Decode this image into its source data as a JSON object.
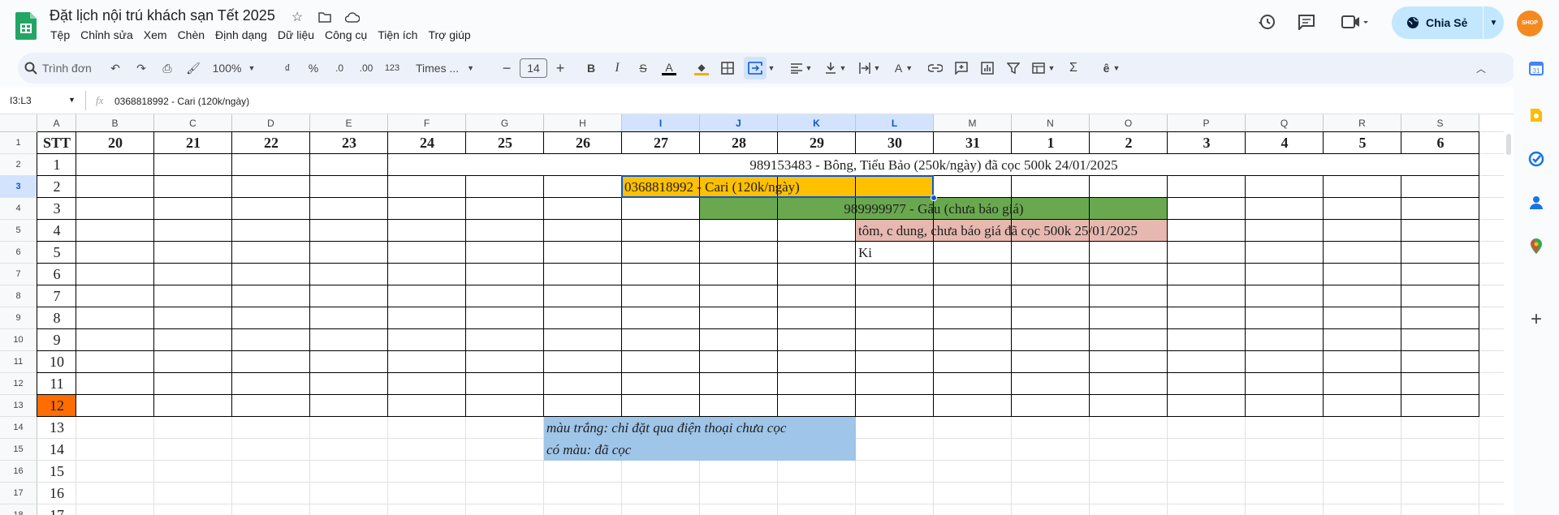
{
  "title": "Đặt lịch nội trú khách sạn Tết 2025",
  "menu": [
    "Tệp",
    "Chỉnh sửa",
    "Xem",
    "Chèn",
    "Định dạng",
    "Dữ liệu",
    "Công cụ",
    "Tiện ích",
    "Trợ giúp"
  ],
  "share_label": "Chia Sẻ",
  "toolbar": {
    "search_placeholder": "Trình đơn",
    "zoom": "100%",
    "currency": "₫",
    "percent": "%",
    "dec_dec": ".0",
    "inc_dec": ".00",
    "num_format": "123",
    "font": "Times ...",
    "font_size": "14"
  },
  "formula_bar": {
    "name_box": "I3:L3",
    "fx": "fx",
    "value": "0368818992 - Cari (120k/ngày)"
  },
  "columns": [
    "A",
    "B",
    "C",
    "D",
    "E",
    "F",
    "G",
    "H",
    "I",
    "J",
    "K",
    "L",
    "M",
    "N",
    "O",
    "P",
    "Q",
    "R",
    "S"
  ],
  "rows": [
    "1",
    "2",
    "3",
    "4",
    "5",
    "6",
    "7",
    "8",
    "9",
    "10",
    "11",
    "12",
    "13",
    "14",
    "15",
    "16",
    "17",
    "18"
  ],
  "header_row": [
    "STT",
    "20",
    "21",
    "22",
    "23",
    "24",
    "25",
    "26",
    "27",
    "28",
    "29",
    "30",
    "31",
    "1",
    "2",
    "3",
    "4",
    "5",
    "6"
  ],
  "stt": [
    "1",
    "2",
    "3",
    "4",
    "5",
    "6",
    "7",
    "8",
    "9",
    "10",
    "11",
    "12",
    "13",
    "14",
    "15",
    "16",
    "17"
  ],
  "bookings": {
    "b1": "989153483 - Bông, Tiểu Bảo (250k/ngày) đã cọc 500k 24/01/2025",
    "b2": "0368818992 - Cari (120k/ngày)",
    "b3": "989999977 - Gấu (chưa báo giá)",
    "b4": "tôm, c dung, chưa báo giá đã cọc 500k 25/01/2025",
    "b5": "Ki"
  },
  "legend": {
    "white": "màu trắng: chỉ đặt qua điện thoại chưa cọc",
    "colored": "có màu: đã cọc"
  },
  "colors": {
    "orange": "#ffc000",
    "green": "#6aa84f",
    "pink": "#e6b8af",
    "blue": "#9fc5e8",
    "row12": "#ff6d01",
    "accent": "#0b57d0"
  },
  "avatar_text": "SHOP"
}
